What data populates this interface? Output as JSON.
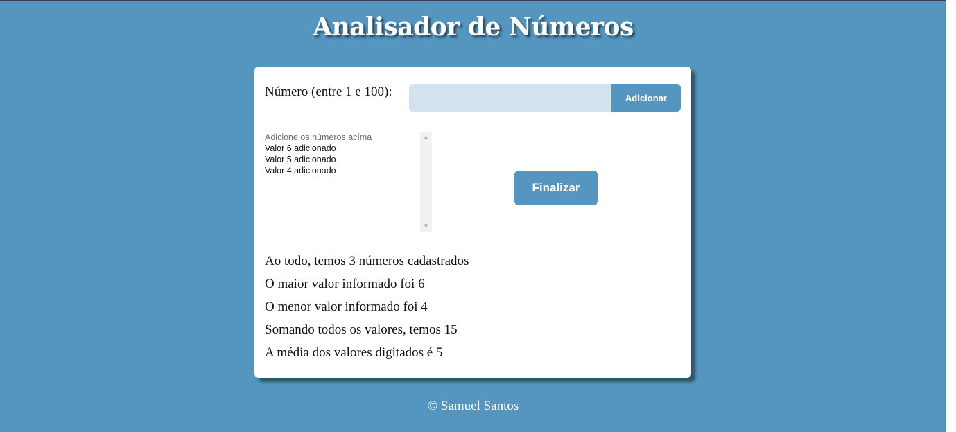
{
  "page": {
    "title": "Analisador de Números",
    "footer": "© Samuel Santos"
  },
  "form": {
    "number_label": "Número (entre 1 e 100):",
    "number_value": "",
    "add_button": "Adicionar"
  },
  "list": {
    "items": [
      "Adicione os números acíma",
      "Valor 6 adicionado",
      "Valor 5 adicionado",
      "Valor 4 adicionado"
    ]
  },
  "finish_button": "Finalizar",
  "results": [
    "Ao todo, temos 3 números cadastrados",
    "O maior valor informado foi 6",
    "O menor valor informado foi 4",
    "Somando todos os valores, temos 15",
    "A média dos valores digitados é 5"
  ],
  "colors": {
    "background": "#5596c0",
    "card": "#ffffff",
    "input_bg": "#d3e3ed",
    "button": "#5596c0"
  },
  "icons": {
    "scroll_up": "arrow-up-icon",
    "scroll_down": "arrow-down-icon"
  }
}
